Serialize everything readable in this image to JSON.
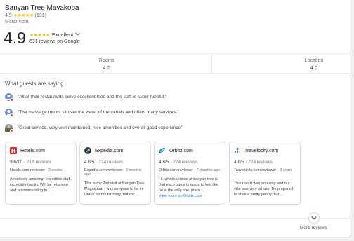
{
  "hotel": {
    "name": "Banyan Tree Mayakoba",
    "rating": "4.9",
    "stars": "★★★★★",
    "review_count_paren": "(631)",
    "hotel_class": "5-star hotel"
  },
  "summary": {
    "score": "4.9",
    "stars": "★★★★★",
    "rating_label": "Excellent",
    "reviews_text": "631 reviews on Google"
  },
  "category_ratings": [
    {
      "label": "Rooms",
      "value": "4.5"
    },
    {
      "label": "Location",
      "value": "4.0"
    }
  ],
  "guests_section": {
    "title": "What guests are saying",
    "quotes": [
      "\"All of their restaurants serve excellent food and the staff is super helpful.\"",
      "\"The massage rooms sit over the water of the canals and offers many services.\"",
      "\"Great service, very well maintained, nice amenities and overall good experience\""
    ]
  },
  "review_cards": [
    {
      "source": "Hotels.com",
      "rating": "9.6/10",
      "count": "· 218 reviews",
      "reviewer": "Hotels.com reviewer",
      "when": "· 3 weeks ...",
      "text": "Absolutely amazing. Incredible staff, incredible facility. Will be returning and recommending to ...",
      "link": ""
    },
    {
      "source": "Expedia.com",
      "rating": "4.8/5",
      "count": "· 724 reviews",
      "reviewer": "Expedia.com reviewer",
      "when": "· 3 months ago",
      "text": "This is my 2nd visit at Banyan Tree Mayakoba. I was suppose to be in Dubai for my birthday, but my ...",
      "link": ""
    },
    {
      "source": "Orbitz.com",
      "rating": "4.8/5",
      "count": "· 724 reviews",
      "reviewer": "Orbitz.com reviewer",
      "when": "· 7 months ago",
      "text": "Hi, what's unique at banyan tree is that each guest is made to feel like he is the only one, place ...",
      "link": "View more on Orbitz.com"
    },
    {
      "source": "Travelocity.com",
      "rating": "4.8/5",
      "count": "· 724 reviews",
      "reviewer": "Travelocity.com reviewer",
      "when": "· 3 years ...",
      "text": "This resort was amazing and our villa was very private! Be prepared to shell a pretty penny, but ...",
      "link": ""
    }
  ],
  "more_reviews_label": "More reviews",
  "colors": {
    "star": "#fbbc04",
    "link": "#1a73e8",
    "hotels_brand": "#d32f2f",
    "expedia_brand": "#1f3a5f",
    "orbitz_brand": "#0a7cc1",
    "travelocity_brand": "#3a6ed6"
  }
}
